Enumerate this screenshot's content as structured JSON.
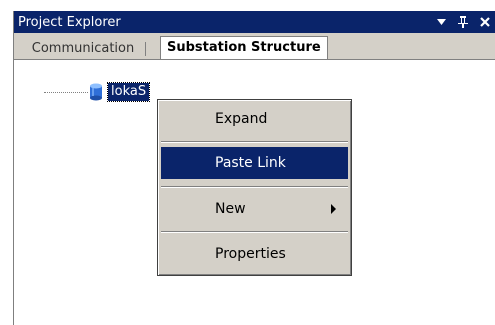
{
  "panel": {
    "title": "Project Explorer",
    "controls": {
      "dropdown": "▾",
      "pin": "⊥",
      "close": "✕"
    }
  },
  "tabs": [
    {
      "label": "Communication"
    },
    {
      "label": "Substation Structure"
    }
  ],
  "tree": {
    "node_label": "lokaS"
  },
  "context_menu": {
    "items": [
      {
        "label": "Expand"
      },
      {
        "label": "Paste Link"
      },
      {
        "label": "New"
      },
      {
        "label": "Properties"
      }
    ]
  },
  "colors": {
    "selection": "#0a246a",
    "chrome": "#d4d0c8"
  },
  "icons": {
    "node": "database-cylinder-icon",
    "submenu": "submenu-arrow-icon"
  }
}
